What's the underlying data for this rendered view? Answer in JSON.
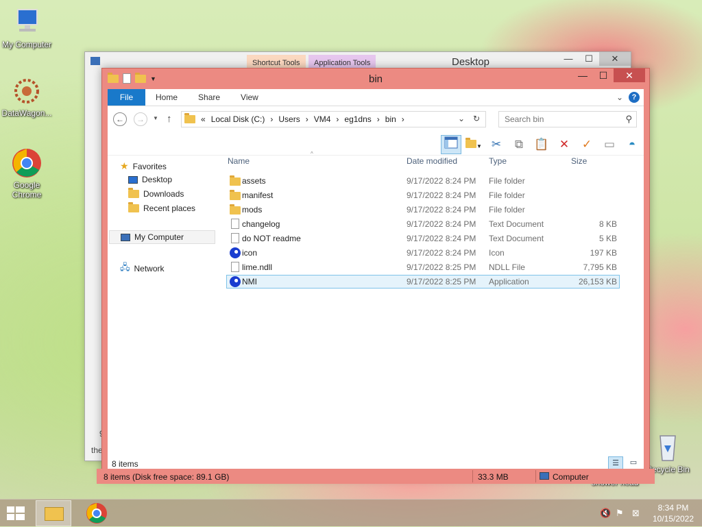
{
  "desktop": {
    "icons": [
      {
        "label": "My Computer"
      },
      {
        "label": "DataWagon..."
      },
      {
        "label": "Google Chrome"
      },
      {
        "label": "Recycle Bin"
      },
      {
        "label": "shower head"
      }
    ]
  },
  "back_window": {
    "title": "Desktop",
    "context_tabs": [
      "Shortcut Tools",
      "Application Tools"
    ],
    "fragments": [
      "9",
      "the"
    ]
  },
  "window": {
    "title": "bin",
    "ribbon": {
      "file": "File",
      "tabs": [
        "Home",
        "Share",
        "View"
      ]
    },
    "breadcrumb": [
      "Local Disk (C:)",
      "Users",
      "VM4",
      "eg1dns",
      "bin"
    ],
    "breadcrumb_overflow": "«",
    "search_placeholder": "Search bin",
    "nav_pane": {
      "favorites": "Favorites",
      "favorites_items": [
        "Desktop",
        "Downloads",
        "Recent places"
      ],
      "computer": "My Computer",
      "network": "Network"
    },
    "columns": [
      "Name",
      "Date modified",
      "Type",
      "Size"
    ],
    "files": [
      {
        "name": "assets",
        "date": "9/17/2022 8:24 PM",
        "type": "File folder",
        "size": "",
        "icon": "folder-icon"
      },
      {
        "name": "manifest",
        "date": "9/17/2022 8:24 PM",
        "type": "File folder",
        "size": "",
        "icon": "folder-icon"
      },
      {
        "name": "mods",
        "date": "9/17/2022 8:24 PM",
        "type": "File folder",
        "size": "",
        "icon": "folder-icon"
      },
      {
        "name": "changelog",
        "date": "9/17/2022 8:24 PM",
        "type": "Text Document",
        "size": "8 KB",
        "icon": "text-document-icon"
      },
      {
        "name": "do NOT readme",
        "date": "9/17/2022 8:24 PM",
        "type": "Text Document",
        "size": "5 KB",
        "icon": "text-document-icon"
      },
      {
        "name": "icon",
        "date": "9/17/2022 8:24 PM",
        "type": "Icon",
        "size": "197 KB",
        "icon": "app-icon"
      },
      {
        "name": "lime.ndll",
        "date": "9/17/2022 8:25 PM",
        "type": "NDLL File",
        "size": "7,795 KB",
        "icon": "file-icon"
      },
      {
        "name": "NMI",
        "date": "9/17/2022 8:25 PM",
        "type": "Application",
        "size": "26,153 KB",
        "icon": "app-icon",
        "selected": true
      }
    ],
    "item_count": "8 items",
    "status": {
      "disk": "8 items (Disk free space: 89.1 GB)",
      "size": "33.3 MB",
      "location": "Computer"
    }
  },
  "taskbar": {
    "clock_time": "8:34 PM",
    "clock_date": "10/15/2022"
  },
  "colors": {
    "window_frame": "#ec8a82",
    "file_tab": "#1979ca",
    "close_button": "#c75050",
    "selection": "#e5f3fb"
  }
}
